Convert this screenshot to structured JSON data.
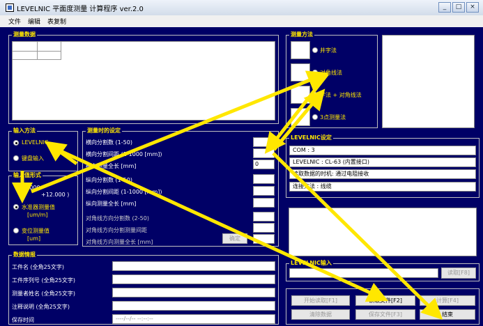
{
  "window": {
    "title": "LEVELNIC 平面度测量 计算程序 ver.2.0",
    "minimize": "_",
    "maximize": "□",
    "close": "×"
  },
  "menu": [
    "文件",
    "编辑",
    "表复制"
  ],
  "measurement_data": {
    "legend": "测量数据"
  },
  "method": {
    "legend": "测量方法",
    "options": [
      "井字法",
      "对角线法",
      "字法 + 对角线法",
      "3点测量法"
    ],
    "selected": 1
  },
  "input_method": {
    "legend": "输入方法",
    "options": [
      "LEVELNIC",
      "键盘输入"
    ],
    "selected": 0
  },
  "unit_group": {
    "legend": "输入值形式",
    "range_left": "( -12.000",
    "range_right": "+12.000 )",
    "options": [
      "水准器测量值",
      "变位测量值"
    ],
    "units": [
      "[um/m]",
      "[um]"
    ],
    "selected": 0
  },
  "settings": {
    "legend": "测量时的设定",
    "rows": [
      "横向分割数 (1-50)",
      "横向分割间距 (1-1000 [mm])",
      "横向测量全长 [mm]",
      "纵向分割数 (1-50)",
      "纵向分割间距 (1-1000 [mm])",
      "纵向测量全长 [mm]",
      "对角线方向分割数 (2-50)",
      "对角线方向分割测量间距",
      "对角线方向测量全长 [mm]"
    ],
    "value_row3": "0",
    "confirm": "确定"
  },
  "levelnic": {
    "legend": "LEVELNIC设定",
    "com": "COM : 3",
    "model": "LEVELNIC : CL-63 (内置接口)",
    "auto": "读取数据的时机: 通过电阻接收",
    "trigger": "连接方法 : 线缆"
  },
  "levelnic_input": {
    "legend": "LEVELNIC输入",
    "read_button": "读取[F8]"
  },
  "workpiece": {
    "legend": "数据情报",
    "rows": [
      "工件名 (全角25文字)",
      "工件序列号 (全角25文字)",
      "测量者姓名 (全角25文字)",
      "注释说明 (全角25文字)",
      "保存时间"
    ],
    "date_placeholder": "----/--/-- --:--:--"
  },
  "buttons": {
    "start": "开始读取[F1]",
    "read_file": "读取文件[F2]",
    "calculate": "计算[F4]",
    "clear": "清除数据",
    "save": "保存文件[F3]",
    "end": "结束"
  },
  "accent": "#ffe700"
}
